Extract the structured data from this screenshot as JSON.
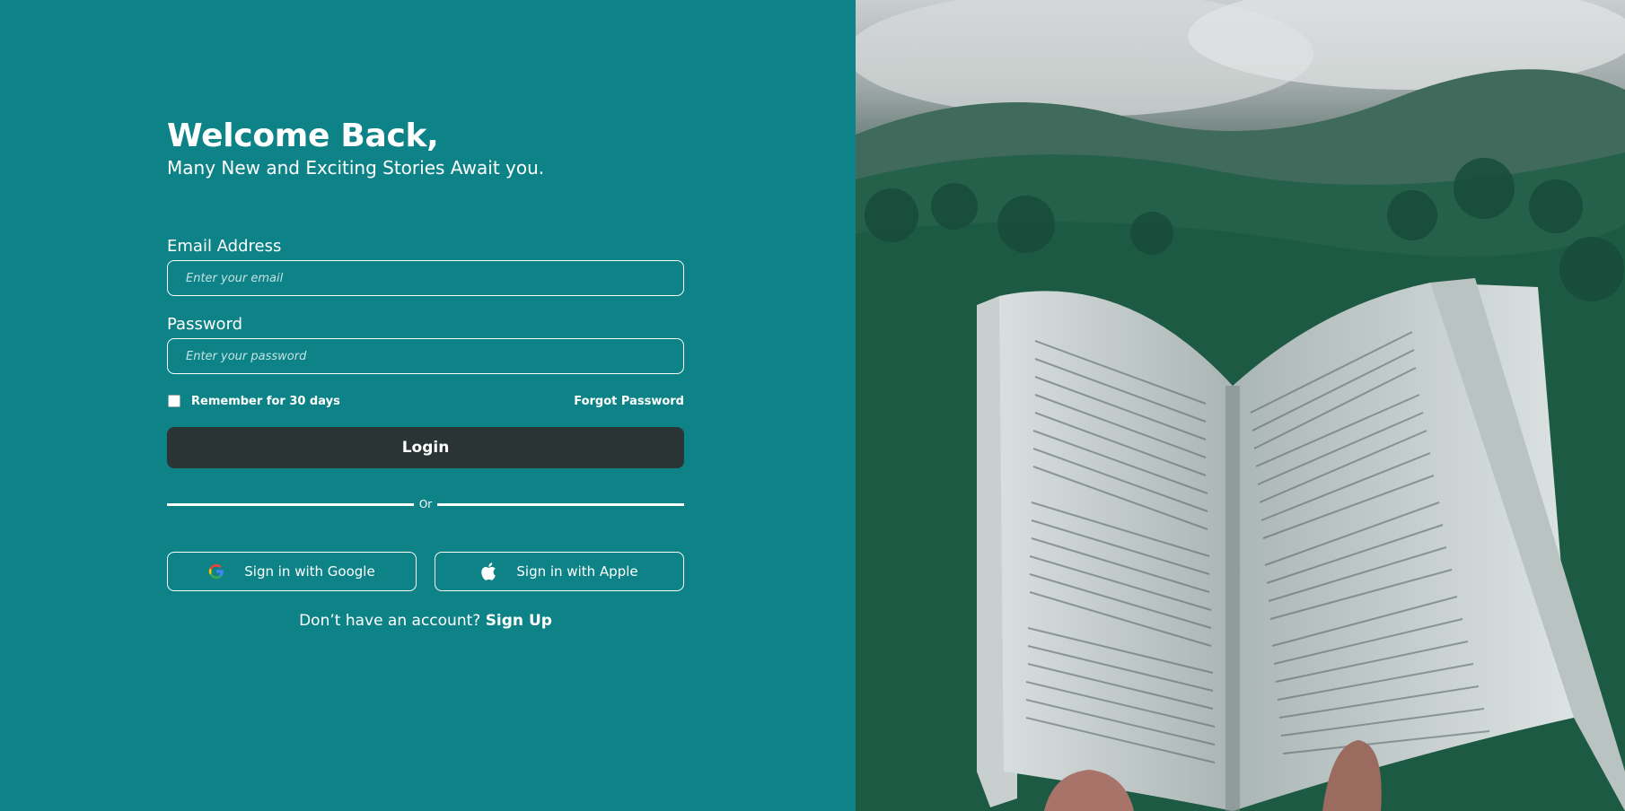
{
  "header": {
    "title": "Welcome Back,",
    "subtitle": "Many New and Exciting Stories Await you."
  },
  "form": {
    "email_label": "Email Address",
    "email_placeholder": "Enter your email",
    "email_value": "",
    "password_label": "Password",
    "password_placeholder": "Enter your password",
    "password_value": "",
    "remember_label": "Remember for 30 days",
    "remember_checked": false,
    "forgot_label": "Forgot Password",
    "login_label": "Login",
    "divider_label": "Or"
  },
  "social": {
    "google_label": "Sign in with Google",
    "google_icon": "google-icon",
    "apple_label": "Sign in with Apple",
    "apple_icon": "apple-icon"
  },
  "signup": {
    "prompt": "Don’t have an account?",
    "link_label": "Sign Up"
  },
  "colors": {
    "background": "#0e8387",
    "button": "#2b3435",
    "text": "#ffffff"
  }
}
